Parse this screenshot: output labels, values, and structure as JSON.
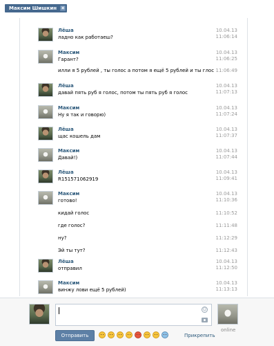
{
  "tab": {
    "title": "Максим Шишкин",
    "close": "✖"
  },
  "messages": [
    {
      "author": "Лёша",
      "text": "ладно как работаеш?",
      "date": "10.04.13",
      "time": "11:06:14",
      "avatar": "lesha"
    },
    {
      "author": "Максим",
      "text": "Гарант?",
      "date": "10.04.13",
      "time": "11:06:25",
      "avatar": "maksim"
    },
    {
      "author": "",
      "text": "илли я 5 рублей , ты голос а потом я ещё 5 рублей и ты глос",
      "date": "",
      "time": "11:06:49"
    },
    {
      "author": "Лёша",
      "text": "давай пять руб я голос, потом ты пять руб я голос",
      "date": "10.04.13",
      "time": "11:07:13",
      "avatar": "lesha"
    },
    {
      "author": "Максим",
      "text": "Ну я так и говорю)",
      "date": "10.04.13",
      "time": "11:07:24",
      "avatar": "maksim"
    },
    {
      "author": "Лёша",
      "text": "щас кошель дам",
      "date": "10.04.13",
      "time": "11:07:37",
      "avatar": "lesha"
    },
    {
      "author": "Максим",
      "text": "Давай!)",
      "date": "10.04.13",
      "time": "11:07:44",
      "avatar": "maksim"
    },
    {
      "author": "Лёша",
      "text": "R151571062919",
      "date": "10.04.13",
      "time": "11:09:41",
      "avatar": "lesha"
    },
    {
      "author": "Максим",
      "text": "готово!",
      "date": "10.04.13",
      "time": "11:10:36",
      "avatar": "maksim"
    },
    {
      "author": "",
      "text": "кидай голос",
      "date": "",
      "time": "11:10:52"
    },
    {
      "author": "",
      "text": "где голос?",
      "date": "",
      "time": "11:11:48"
    },
    {
      "author": "",
      "text": "ну?",
      "date": "",
      "time": "11:12:29"
    },
    {
      "author": "",
      "text": "Эй ты тут?",
      "date": "",
      "time": "11:12:43"
    },
    {
      "author": "Лёша",
      "text": "отправил",
      "date": "10.04.13",
      "time": "11:12:50",
      "avatar": "lesha"
    },
    {
      "author": "Максим",
      "text": "винжу лови ещё 5 рублей)",
      "date": "10.04.13",
      "time": "11:13:13",
      "avatar": "maksim"
    }
  ],
  "compose": {
    "send_label": "Отправить",
    "attach_label": "Прикрепить",
    "status": "online",
    "smile_glyph": "☺"
  },
  "colors": {
    "accent": "#45688e",
    "link": "#2b587a",
    "send": "#5d80a6"
  }
}
